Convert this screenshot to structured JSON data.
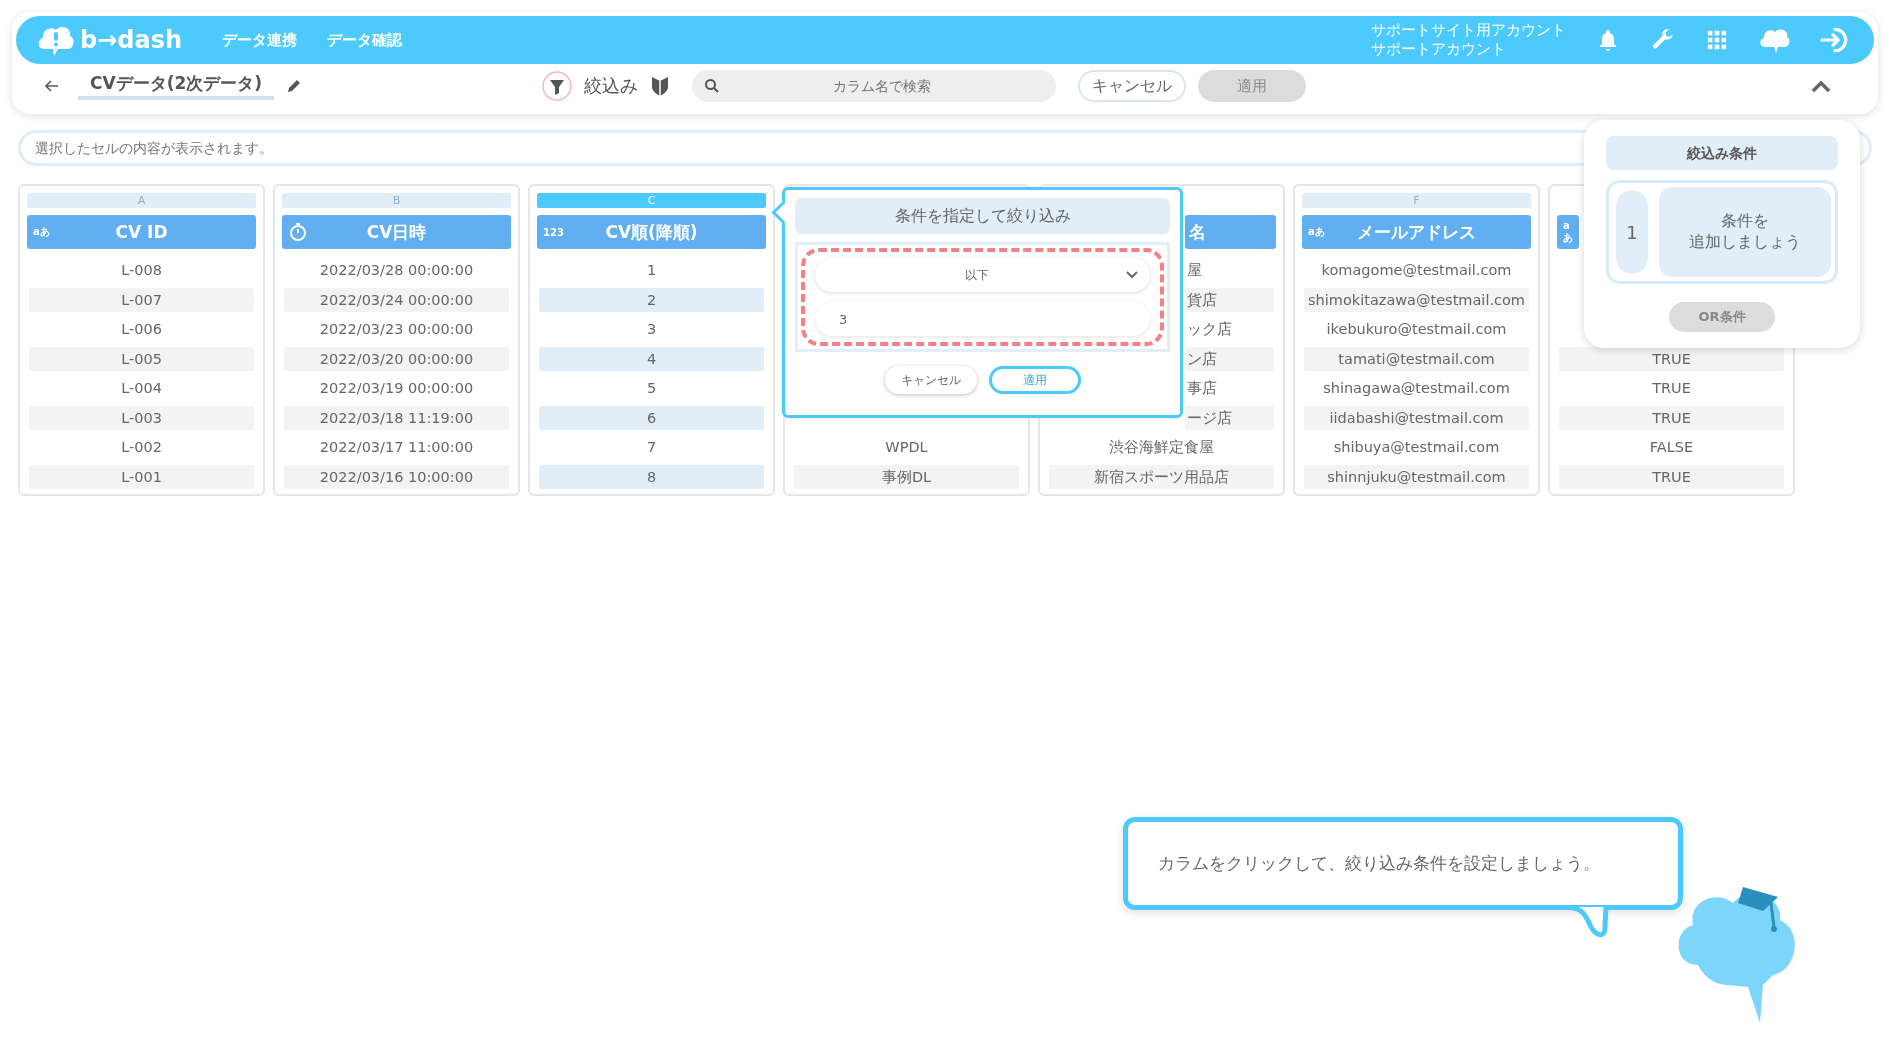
{
  "app": {
    "logo": "b→dash",
    "nav": [
      {
        "label": "データ連携"
      },
      {
        "label": "データ確認"
      }
    ],
    "account": [
      "サポートサイト用アカウント",
      "サポートアカウント"
    ]
  },
  "toolbar": {
    "title": "CVデータ(2次データ)",
    "filter_label": "絞込み",
    "search": {
      "placeholder": "カラム名で検索"
    },
    "cancel": "キャンセル",
    "apply": {
      "label": "適用",
      "disabled": true
    }
  },
  "cell_preview": {
    "placeholder": "選択したセルの内容が表示されます。"
  },
  "columns": [
    {
      "letter": "A",
      "title": "CV ID",
      "kind": "badge",
      "badge": "aあ",
      "selected": false,
      "cells": [
        "L-008",
        "L-007",
        "L-006",
        "L-005",
        "L-004",
        "L-003",
        "L-002",
        "L-001"
      ]
    },
    {
      "letter": "B",
      "title": "CV日時",
      "kind": "stopwatch",
      "selected": false,
      "cells": [
        "2022/03/28 00:00:00",
        "2022/03/24 00:00:00",
        "2022/03/23 00:00:00",
        "2022/03/20 00:00:00",
        "2022/03/19 00:00:00",
        "2022/03/18 11:19:00",
        "2022/03/17 11:00:00",
        "2022/03/16 10:00:00"
      ]
    },
    {
      "letter": "C",
      "title": "CV順(降順)",
      "kind": "badge",
      "badge": "123",
      "selected": true,
      "cells": [
        "1",
        "2",
        "3",
        "4",
        "5",
        "6",
        "7",
        "8"
      ]
    },
    {
      "selected": false,
      "cells": [
        "WPDL",
        "事例DL"
      ]
    },
    {
      "title": "名",
      "title_clipped": true,
      "selected": false,
      "cells": [
        {
          "text": "屋",
          "clipped": true
        },
        {
          "text": "貨店",
          "clipped": true
        },
        {
          "text": "ック店",
          "clipped": true
        },
        {
          "text": "ン店",
          "clipped": true
        },
        {
          "text": "事店",
          "clipped": true
        },
        {
          "text": "ージ店",
          "clipped": true
        },
        {
          "text": "渋谷海鮮定食屋",
          "clipped": false
        },
        {
          "text": "新宿スポーツ用品店",
          "clipped": false
        }
      ]
    },
    {
      "letter": "F",
      "title": "メールアドレス",
      "kind": "badge",
      "badge": "aあ",
      "selected": false,
      "cells": [
        "komagome@testmail.com",
        "shimokitazawa@testmail.com",
        "ikebukuro@testmail.com",
        "tamati@testmail.com",
        "shinagawa@testmail.com",
        "iidabashi@testmail.com",
        "shibuya@testmail.com",
        "shinnjuku@testmail.com"
      ]
    },
    {
      "kind": "badge",
      "badge": "aあ",
      "selected": false,
      "cells": [
        "TRUE",
        "TRUE",
        "TRUE",
        "FALSE",
        "TRUE"
      ]
    }
  ],
  "filter_popup": {
    "title": "条件を指定して絞り込み",
    "operator": "以下",
    "value": "3",
    "cancel": "キャンセル",
    "apply": "適用"
  },
  "conditions_panel": {
    "title": "絞込み条件",
    "conditions": [
      {
        "index": "1",
        "lines": [
          "条件を",
          "追加しましょう"
        ]
      }
    ],
    "or_button": {
      "label": "OR条件",
      "disabled": true
    }
  },
  "hint": {
    "text": "カラムをクリックして、絞り込み条件を設定しましょう。"
  }
}
